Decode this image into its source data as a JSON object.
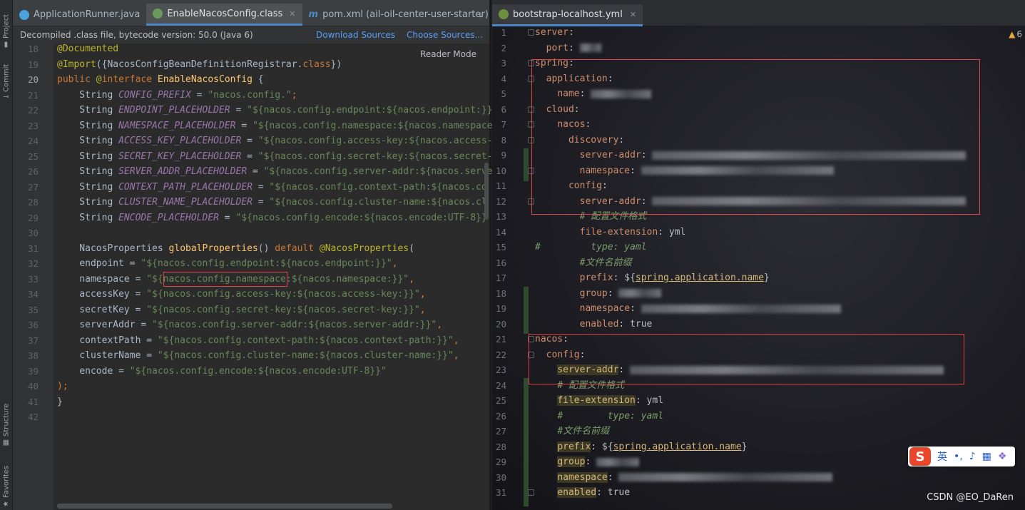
{
  "toolwindows": {
    "project": "Project",
    "commit": "Commit",
    "structure": "Structure",
    "favorites": "Favorites"
  },
  "left_tabs": [
    {
      "label": "ApplicationRunner.java",
      "icon": "class-icon",
      "color": "#4aa3df"
    },
    {
      "label": "EnableNacosConfig.class",
      "icon": "annotation-class-icon",
      "color": "#6a9a5b"
    },
    {
      "label": "pom.xml (ail-oil-center-user-starter)",
      "icon": "maven-icon",
      "color": "#4a88c7"
    }
  ],
  "banner": {
    "text": "Decompiled .class file, bytecode version: 50.0 (Java 6)",
    "download": "Download Sources",
    "choose": "Choose Sources..."
  },
  "reader_mode": "Reader Mode",
  "left_code": [
    {
      "n": "18",
      "tokens": [
        [
          "ann",
          "@Documented"
        ]
      ]
    },
    {
      "n": "19",
      "tokens": [
        [
          "ann",
          "@Import"
        ],
        [
          "plain",
          "({NacosConfigBeanDefinitionRegistrar."
        ],
        [
          "kw",
          "class"
        ],
        [
          "plain",
          "})"
        ]
      ]
    },
    {
      "n": "20",
      "tokens": [
        [
          "kw",
          "public "
        ],
        [
          "ann",
          "@"
        ],
        [
          "kw",
          "interface "
        ],
        [
          "fn",
          "EnableNacosConfig"
        ],
        [
          "plain",
          " {"
        ]
      ]
    },
    {
      "n": "21",
      "tokens": [
        [
          "plain",
          "    String "
        ],
        [
          "const",
          "CONFIG_PREFIX"
        ],
        [
          "plain",
          " = "
        ],
        [
          "str",
          "\"nacos.config.\""
        ],
        [
          "kw",
          ";"
        ]
      ]
    },
    {
      "n": "22",
      "tokens": [
        [
          "plain",
          "    String "
        ],
        [
          "const",
          "ENDPOINT_PLACEHOLDER"
        ],
        [
          "plain",
          " = "
        ],
        [
          "str",
          "\"${nacos.config.endpoint:${nacos.endpoint:}}"
        ]
      ]
    },
    {
      "n": "23",
      "tokens": [
        [
          "plain",
          "    String "
        ],
        [
          "const",
          "NAMESPACE_PLACEHOLDER"
        ],
        [
          "plain",
          " = "
        ],
        [
          "str",
          "\"${nacos.config.namespace:${nacos.namespace"
        ]
      ]
    },
    {
      "n": "24",
      "tokens": [
        [
          "plain",
          "    String "
        ],
        [
          "const",
          "ACCESS_KEY_PLACEHOLDER"
        ],
        [
          "plain",
          " = "
        ],
        [
          "str",
          "\"${nacos.config.access-key:${nacos.access-"
        ]
      ]
    },
    {
      "n": "25",
      "tokens": [
        [
          "plain",
          "    String "
        ],
        [
          "const",
          "SECRET_KEY_PLACEHOLDER"
        ],
        [
          "plain",
          " = "
        ],
        [
          "str",
          "\"${nacos.config.secret-key:${nacos.secret-"
        ]
      ]
    },
    {
      "n": "26",
      "tokens": [
        [
          "plain",
          "    String "
        ],
        [
          "const",
          "SERVER_ADDR_PLACEHOLDER"
        ],
        [
          "plain",
          " = "
        ],
        [
          "str",
          "\"${nacos.config.server-addr:${nacos.serve"
        ]
      ]
    },
    {
      "n": "27",
      "tokens": [
        [
          "plain",
          "    String "
        ],
        [
          "const",
          "CONTEXT_PATH_PLACEHOLDER"
        ],
        [
          "plain",
          " = "
        ],
        [
          "str",
          "\"${nacos.config.context-path:${nacos.co"
        ]
      ]
    },
    {
      "n": "28",
      "tokens": [
        [
          "plain",
          "    String "
        ],
        [
          "const",
          "CLUSTER_NAME_PLACEHOLDER"
        ],
        [
          "plain",
          " = "
        ],
        [
          "str",
          "\"${nacos.config.cluster-name:${nacos.cl"
        ]
      ]
    },
    {
      "n": "29",
      "tokens": [
        [
          "plain",
          "    String "
        ],
        [
          "const",
          "ENCODE_PLACEHOLDER"
        ],
        [
          "plain",
          " = "
        ],
        [
          "str",
          "\"${nacos.config.encode:${nacos.encode:UTF-8}}"
        ]
      ]
    },
    {
      "n": "30",
      "tokens": []
    },
    {
      "n": "31",
      "tokens": [
        [
          "plain",
          "    NacosProperties "
        ],
        [
          "fn",
          "globalProperties"
        ],
        [
          "plain",
          "() "
        ],
        [
          "kw",
          "default "
        ],
        [
          "ann",
          "@NacosProperties"
        ],
        [
          "plain",
          "("
        ]
      ]
    },
    {
      "n": "32",
      "tokens": [
        [
          "plain",
          "    endpoint = "
        ],
        [
          "str",
          "\"${nacos.config.endpoint:${nacos.endpoint:}}\""
        ],
        [
          "kw",
          ","
        ]
      ]
    },
    {
      "n": "33",
      "tokens": [
        [
          "plain",
          "    namespace = "
        ],
        [
          "str",
          "\"${nacos.config.namespace:${nacos.namespace:}}\""
        ],
        [
          "kw",
          ","
        ]
      ]
    },
    {
      "n": "34",
      "tokens": [
        [
          "plain",
          "    accessKey = "
        ],
        [
          "str",
          "\"${nacos.config.access-key:${nacos.access-key:}}\""
        ],
        [
          "kw",
          ","
        ]
      ]
    },
    {
      "n": "35",
      "tokens": [
        [
          "plain",
          "    secretKey = "
        ],
        [
          "str",
          "\"${nacos.config.secret-key:${nacos.secret-key:}}\""
        ],
        [
          "kw",
          ","
        ]
      ]
    },
    {
      "n": "36",
      "tokens": [
        [
          "plain",
          "    serverAddr = "
        ],
        [
          "str",
          "\"${nacos.config.server-addr:${nacos.server-addr:}}\""
        ],
        [
          "kw",
          ","
        ]
      ]
    },
    {
      "n": "37",
      "tokens": [
        [
          "plain",
          "    contextPath = "
        ],
        [
          "str",
          "\"${nacos.config.context-path:${nacos.context-path:}}\""
        ],
        [
          "kw",
          ","
        ]
      ]
    },
    {
      "n": "38",
      "tokens": [
        [
          "plain",
          "    clusterName = "
        ],
        [
          "str",
          "\"${nacos.config.cluster-name:${nacos.cluster-name:}}\""
        ],
        [
          "kw",
          ","
        ]
      ]
    },
    {
      "n": "39",
      "tokens": [
        [
          "plain",
          "    encode = "
        ],
        [
          "str",
          "\"${nacos.config.encode:${nacos.encode:UTF-8}}\""
        ]
      ]
    },
    {
      "n": "40",
      "tokens": [
        [
          "kw",
          ");"
        ]
      ]
    },
    {
      "n": "41",
      "tokens": [
        [
          "plain",
          "}"
        ]
      ]
    },
    {
      "n": "42",
      "tokens": []
    }
  ],
  "right_tab": {
    "label": "bootstrap-localhost.yml",
    "icon": "yaml-icon"
  },
  "warnings": {
    "count": "6"
  },
  "right_code": [
    {
      "n": "1",
      "tokens": [
        [
          "key",
          "server"
        ],
        [
          "yval",
          ":"
        ]
      ]
    },
    {
      "n": "2",
      "tokens": [
        [
          "yval",
          "  "
        ],
        [
          "key",
          "port"
        ],
        [
          "yval",
          ": "
        ],
        [
          "blur",
          "30"
        ]
      ]
    },
    {
      "n": "3",
      "tokens": [
        [
          "key",
          "spring"
        ],
        [
          "yval",
          ":"
        ]
      ]
    },
    {
      "n": "4",
      "tokens": [
        [
          "yval",
          "  "
        ],
        [
          "key",
          "application"
        ],
        [
          "yval",
          ":"
        ]
      ]
    },
    {
      "n": "5",
      "tokens": [
        [
          "yval",
          "    "
        ],
        [
          "key",
          "name"
        ],
        [
          "yval",
          ": "
        ],
        [
          "blur",
          "85"
        ]
      ]
    },
    {
      "n": "6",
      "tokens": [
        [
          "yval",
          "  "
        ],
        [
          "key",
          "cloud"
        ],
        [
          "yval",
          ":"
        ]
      ]
    },
    {
      "n": "7",
      "tokens": [
        [
          "yval",
          "    "
        ],
        [
          "key",
          "nacos"
        ],
        [
          "yval",
          ":"
        ]
      ]
    },
    {
      "n": "8",
      "tokens": [
        [
          "yval",
          "      "
        ],
        [
          "key",
          "discovery"
        ],
        [
          "yval",
          ":"
        ]
      ]
    },
    {
      "n": "9",
      "tokens": [
        [
          "yval",
          "        "
        ],
        [
          "key",
          "server-addr"
        ],
        [
          "yval",
          ": "
        ],
        [
          "blur",
          "440"
        ]
      ]
    },
    {
      "n": "10",
      "tokens": [
        [
          "yval",
          "        "
        ],
        [
          "key",
          "namespace"
        ],
        [
          "yval",
          ": "
        ],
        [
          "blur",
          "270"
        ]
      ]
    },
    {
      "n": "11",
      "tokens": [
        [
          "yval",
          "      "
        ],
        [
          "key",
          "config"
        ],
        [
          "yval",
          ":"
        ]
      ]
    },
    {
      "n": "12",
      "tokens": [
        [
          "yval",
          "        "
        ],
        [
          "key",
          "server-addr"
        ],
        [
          "yval",
          ": "
        ],
        [
          "blur",
          "440"
        ]
      ]
    },
    {
      "n": "13",
      "tokens": [
        [
          "yval",
          "        "
        ],
        [
          "cmt",
          "# 配置文件格式"
        ]
      ]
    },
    {
      "n": "14",
      "tokens": [
        [
          "yval",
          "        "
        ],
        [
          "key",
          "file-extension"
        ],
        [
          "yval",
          ": yml"
        ]
      ]
    },
    {
      "n": "15",
      "tokens": [
        [
          "cmt",
          "#         type: yaml"
        ]
      ]
    },
    {
      "n": "16",
      "tokens": [
        [
          "yval",
          "        "
        ],
        [
          "cmt",
          "#文件名前缀"
        ]
      ]
    },
    {
      "n": "17",
      "tokens": [
        [
          "yval",
          "        "
        ],
        [
          "key",
          "prefix"
        ],
        [
          "yval",
          ": ${"
        ],
        [
          "link",
          "spring.application.name"
        ],
        [
          "yval",
          "}"
        ]
      ]
    },
    {
      "n": "18",
      "tokens": [
        [
          "yval",
          "        "
        ],
        [
          "key",
          "group"
        ],
        [
          "yval",
          ": "
        ],
        [
          "blur",
          "60"
        ]
      ]
    },
    {
      "n": "19",
      "tokens": [
        [
          "yval",
          "        "
        ],
        [
          "key",
          "namespace"
        ],
        [
          "yval",
          ": "
        ],
        [
          "blur",
          "280"
        ]
      ]
    },
    {
      "n": "20",
      "tokens": [
        [
          "yval",
          "        "
        ],
        [
          "key",
          "enabled"
        ],
        [
          "yval",
          ": true"
        ]
      ]
    },
    {
      "n": "21",
      "tokens": [
        [
          "key",
          "nacos"
        ],
        [
          "yval",
          ":"
        ]
      ]
    },
    {
      "n": "22",
      "tokens": [
        [
          "yval",
          "  "
        ],
        [
          "key",
          "config"
        ],
        [
          "yval",
          ":"
        ]
      ]
    },
    {
      "n": "23",
      "tokens": [
        [
          "yval",
          "    "
        ],
        [
          "ykey",
          "server-addr"
        ],
        [
          "yval",
          ": "
        ],
        [
          "blur",
          "440"
        ]
      ]
    },
    {
      "n": "24",
      "tokens": [
        [
          "yval",
          "    "
        ],
        [
          "cmt",
          "# 配置文件格式"
        ]
      ]
    },
    {
      "n": "25",
      "tokens": [
        [
          "yval",
          "    "
        ],
        [
          "ykey",
          "file-extension"
        ],
        [
          "yval",
          ": yml"
        ]
      ]
    },
    {
      "n": "26",
      "tokens": [
        [
          "yval",
          "    "
        ],
        [
          "cmt",
          "#        type: yaml"
        ]
      ]
    },
    {
      "n": "27",
      "tokens": [
        [
          "yval",
          "    "
        ],
        [
          "cmt",
          "#文件名前缀"
        ]
      ]
    },
    {
      "n": "28",
      "tokens": [
        [
          "yval",
          "    "
        ],
        [
          "ykey",
          "prefix"
        ],
        [
          "yval",
          ": ${"
        ],
        [
          "link",
          "spring.application.name"
        ],
        [
          "yval",
          "}"
        ]
      ]
    },
    {
      "n": "29",
      "tokens": [
        [
          "yval",
          "    "
        ],
        [
          "ykey",
          "group"
        ],
        [
          "yval",
          ": "
        ],
        [
          "blur",
          "60"
        ]
      ]
    },
    {
      "n": "30",
      "tokens": [
        [
          "yval",
          "    "
        ],
        [
          "ykey",
          "namespace"
        ],
        [
          "yval",
          ": "
        ],
        [
          "blur",
          "300"
        ]
      ]
    },
    {
      "n": "31",
      "tokens": [
        [
          "yval",
          "    "
        ],
        [
          "ykey",
          "enabled"
        ],
        [
          "yval",
          ": true"
        ]
      ]
    }
  ],
  "ime": {
    "lang": "英",
    "punct": "•,"
  },
  "watermark": "CSDN @EO_DaRen",
  "colors": {
    "red_box": "#e04545",
    "accent": "#4a88c7"
  }
}
